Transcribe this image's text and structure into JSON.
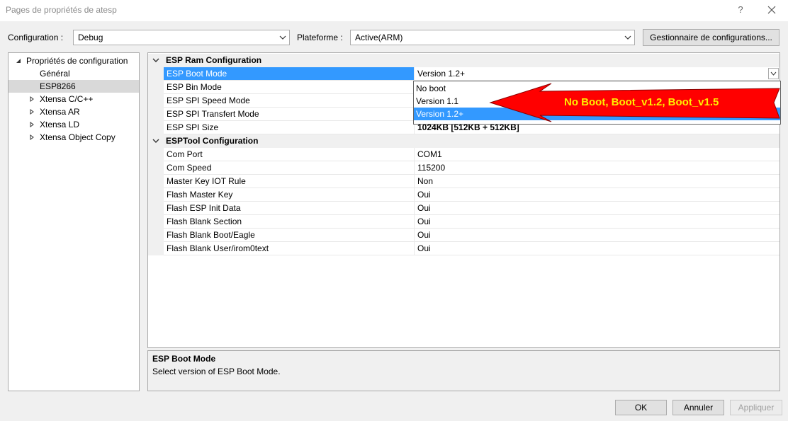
{
  "window": {
    "title": "Pages de propriétés de atesp",
    "help_glyph": "?",
    "close_icon": "close-icon"
  },
  "toolbar": {
    "config_label": "Configuration :",
    "config_value": "Debug",
    "platform_label": "Plateforme :",
    "platform_value": "Active(ARM)",
    "config_manager_label": "Gestionnaire de configurations..."
  },
  "tree": {
    "root": "Propriétés de configuration",
    "items": [
      "Général",
      "ESP8266",
      "Xtensa C/C++",
      "Xtensa AR",
      "Xtensa LD",
      "Xtensa Object Copy"
    ],
    "selected": "ESP8266"
  },
  "grid": {
    "categories": [
      {
        "label": "ESP Ram Configuration",
        "rows": [
          {
            "name": "ESP Boot Mode",
            "value": "Version 1.2+"
          },
          {
            "name": "ESP Bin Mode",
            "value": ""
          },
          {
            "name": "ESP SPI Speed Mode",
            "value": ""
          },
          {
            "name": "ESP SPI Transfert Mode",
            "value": ""
          },
          {
            "name": "ESP SPI Size",
            "value": "1024KB [512KB + 512KB]"
          }
        ]
      },
      {
        "label": "ESPTool Configuration",
        "rows": [
          {
            "name": "Com Port",
            "value": "COM1"
          },
          {
            "name": "Com Speed",
            "value": "115200"
          },
          {
            "name": "Master Key IOT Rule",
            "value": "Non"
          },
          {
            "name": "Flash Master Key",
            "value": "Oui"
          },
          {
            "name": "Flash ESP Init Data",
            "value": "Oui"
          },
          {
            "name": "Flash Blank Section",
            "value": "Oui"
          },
          {
            "name": "Flash Blank Boot/Eagle",
            "value": "Oui"
          },
          {
            "name": "Flash Blank User/irom0text",
            "value": "Oui"
          }
        ]
      }
    ],
    "dropdown_options": [
      "No boot",
      "Version 1.1",
      "Version 1.2+"
    ],
    "dropdown_selected": "Version 1.2+"
  },
  "annotation": {
    "text": "No Boot, Boot_v1.2, Boot_v1.5",
    "arrow_color": "#ff0000",
    "text_color": "#ffee00"
  },
  "description": {
    "title": "ESP Boot Mode",
    "text": "Select version of ESP Boot Mode."
  },
  "buttons": {
    "ok": "OK",
    "cancel": "Annuler",
    "apply": "Appliquer"
  },
  "colors": {
    "selection": "#3399ff",
    "background": "#f0f0f0"
  }
}
